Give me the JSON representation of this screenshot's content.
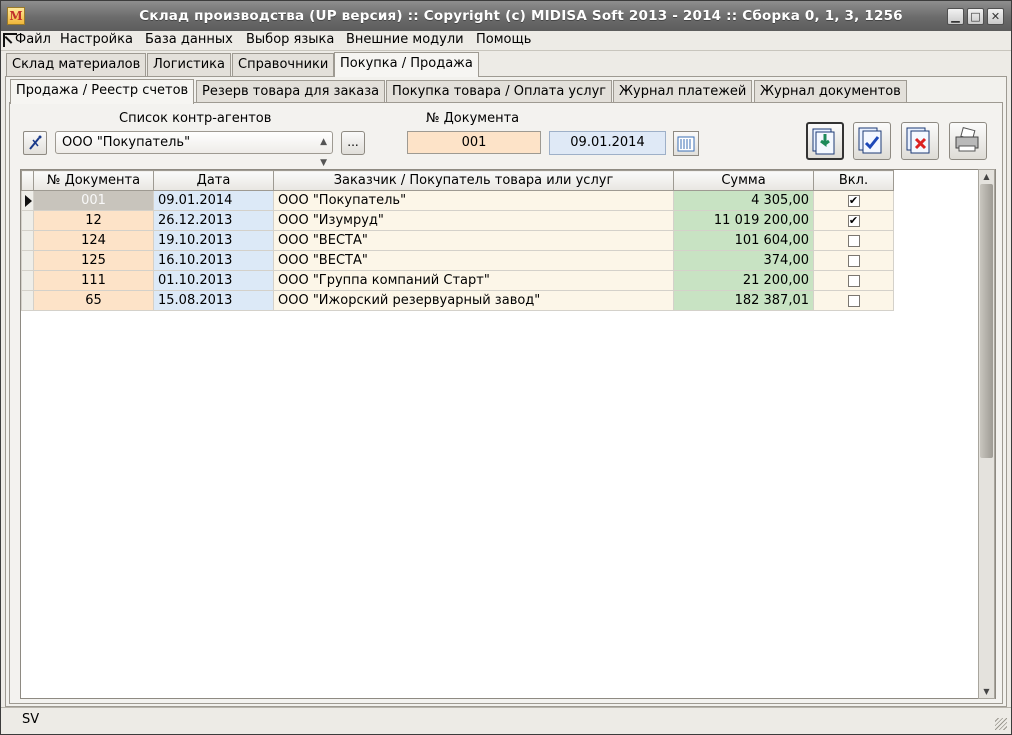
{
  "window": {
    "title": "Склад производства (UP версия) :: Copyright (c) MIDISA Soft 2013 - 2014 :: Сборка 0, 1, 3, 1256",
    "app_icon_letter": "M"
  },
  "menu": [
    "Файл",
    "Настройка",
    "База данных",
    "Выбор языка",
    "Внешние модули",
    "Помощь"
  ],
  "tabs_top": [
    "Склад материалов",
    "Логистика",
    "Справочники",
    "Покупка / Продажа"
  ],
  "tabs_sub": [
    "Продажа / Реестр счетов",
    "Резерв товара для заказа",
    "Покупка товара / Оплата услуг",
    "Журнал платежей",
    "Журнал документов"
  ],
  "form": {
    "contractors_label": "Список контр-агентов",
    "contractor_value": "ООО \"Покупатель\"",
    "dots_label": "...",
    "docnum_label": "№ Документа",
    "docnum_value": "001",
    "date_value": "09.01.2014"
  },
  "table": {
    "headers": [
      "№ Документа",
      "Дата",
      "Заказчик / Покупатель товара или услуг",
      "Сумма",
      "Вкл."
    ],
    "rows": [
      {
        "num": "001",
        "date": "09.01.2014",
        "customer": "ООО \"Покупатель\"",
        "sum": "4 305,00",
        "checked": true,
        "selected": true
      },
      {
        "num": "12",
        "date": "26.12.2013",
        "customer": "ООО \"Изумруд\"",
        "sum": "11 019 200,00",
        "checked": true,
        "selected": false
      },
      {
        "num": "124",
        "date": "19.10.2013",
        "customer": "ООО \"ВЕСТА\"",
        "sum": "101 604,00",
        "checked": false,
        "selected": false
      },
      {
        "num": "125",
        "date": "16.10.2013",
        "customer": "ООО \"ВЕСТА\"",
        "sum": "374,00",
        "checked": false,
        "selected": false
      },
      {
        "num": "111",
        "date": "01.10.2013",
        "customer": "ООО \"Группа компаний Старт\"",
        "sum": "21 200,00",
        "checked": false,
        "selected": false
      },
      {
        "num": "65",
        "date": "15.08.2013",
        "customer": "ООО \"Ижорский резервуарный завод\"",
        "sum": "182 387,01",
        "checked": false,
        "selected": false
      }
    ]
  },
  "status": {
    "text": "SV"
  },
  "colors": {
    "docnum_bg": "#fde3c8",
    "date_bg": "#dce9f7",
    "sum_bg": "#c8e3c3",
    "customer_bg": "#fcf6e8"
  }
}
